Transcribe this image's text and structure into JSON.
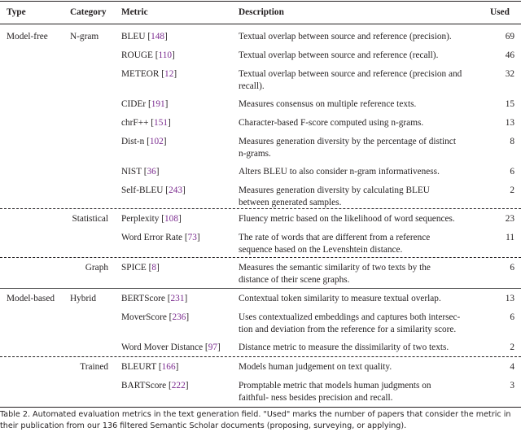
{
  "headers": {
    "type": "Type",
    "category": "Category",
    "metric": "Metric",
    "description": "Description",
    "used": "Used"
  },
  "rows": [
    {
      "type": "Model-free",
      "category": "N-gram",
      "metric": "BLEU",
      "ref": "148",
      "description": "Textual overlap between source and reference (precision).",
      "used": "69"
    },
    {
      "type": "",
      "category": "",
      "metric": "ROUGE",
      "ref": "110",
      "description": "Textual overlap between source and reference (recall).",
      "used": "46"
    },
    {
      "type": "",
      "category": "",
      "metric": "METEOR",
      "ref": "12",
      "description": "Textual overlap between source and reference (precision and recall).",
      "used": "32"
    },
    {
      "type": "",
      "category": "",
      "metric": "CIDEr",
      "ref": "191",
      "description": "Measures consensus on multiple reference texts.",
      "used": "15"
    },
    {
      "type": "",
      "category": "",
      "metric": "chrF++",
      "ref": "151",
      "description": "Character-based F-score computed using n-grams.",
      "used": "13"
    },
    {
      "type": "",
      "category": "",
      "metric": "Dist-n",
      "ref": "102",
      "description": "Measures generation diversity by the percentage of distinct n-grams.",
      "used": "8"
    },
    {
      "type": "",
      "category": "",
      "metric": "NIST",
      "ref": "36",
      "description": "Alters BLEU to also consider n-gram informativeness.",
      "used": "6"
    },
    {
      "type": "",
      "category": "",
      "metric": "Self-BLEU",
      "ref": "243",
      "description": "Measures generation diversity by calculating BLEU between generated samples.",
      "used": "2"
    },
    {
      "type": "",
      "category": "Statistical",
      "metric": "Perplexity",
      "ref": "108",
      "description": "Fluency metric based on the likelihood of word sequences.",
      "used": "23"
    },
    {
      "type": "",
      "category": "",
      "metric": "Word Error Rate",
      "ref": "73",
      "description": "The rate of words that are different from a reference sequence based on the Levenshtein distance.",
      "used": "11"
    },
    {
      "type": "",
      "category": "Graph",
      "metric": "SPICE",
      "ref": "8",
      "description": "Measures the semantic similarity of two texts by the distance of their scene graphs.",
      "used": "6"
    },
    {
      "type": "Model-based",
      "category": "Hybrid",
      "metric": "BERTScore",
      "ref": "231",
      "description": "Contextual token similarity to measure textual overlap.",
      "used": "13"
    },
    {
      "type": "",
      "category": "",
      "metric": "MoverScore",
      "ref": "236",
      "description": "Uses contextualized embeddings and captures both intersec- tion and deviation from the reference for a similarity score.",
      "used": "6"
    },
    {
      "type": "",
      "category": "",
      "metric": "Word Mover Distance",
      "ref": "97",
      "description": "Distance metric to measure the dissimilarity of two texts.",
      "used": "2"
    },
    {
      "type": "",
      "category": "Trained",
      "metric": "BLEURT",
      "ref": "166",
      "description": "Models human judgement on text quality.",
      "used": "4"
    },
    {
      "type": "",
      "category": "",
      "metric": "BARTScore",
      "ref": "222",
      "description": "Promptable metric that models human judgments on faithful- ness besides precision and recall.",
      "used": "3"
    }
  ],
  "caption": "Table 2.   Automated evaluation metrics in the text generation field. \"Used\" marks the number of papers that consider the metric in their publication from our 136 filtered Semantic Scholar documents (proposing, surveying, or applying)."
}
